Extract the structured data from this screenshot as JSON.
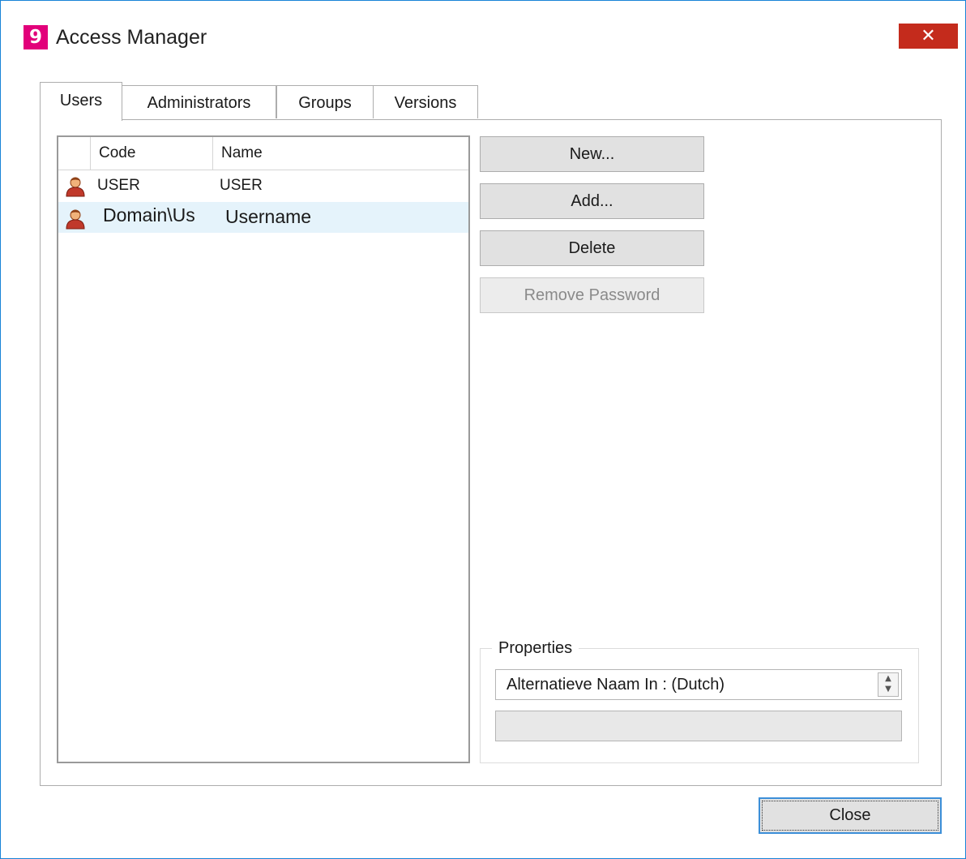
{
  "window": {
    "title": "Access Manager",
    "app_icon_glyph": "9",
    "close_glyph": "✕"
  },
  "tabs": [
    {
      "label": "Users",
      "active": true
    },
    {
      "label": "Administrators",
      "active": false
    },
    {
      "label": "Groups",
      "active": false
    },
    {
      "label": "Versions",
      "active": false
    }
  ],
  "user_list": {
    "columns": [
      "Code",
      "Name"
    ],
    "rows": [
      {
        "code": "USER",
        "name": "USER",
        "icon": "user-icon",
        "selected": false
      },
      {
        "code": "Domain\\Us",
        "name": "Username",
        "icon": "user-icon",
        "selected": true
      }
    ]
  },
  "actions": {
    "new_label": "New...",
    "add_label": "Add...",
    "delete_label": "Delete",
    "remove_password_label": "Remove Password"
  },
  "properties": {
    "title": "Properties",
    "selected_property": "Alternatieve Naam In : (Dutch)",
    "value": ""
  },
  "footer": {
    "close_label": "Close"
  },
  "colors": {
    "accent_border": "#1883d7",
    "brand_icon": "#e2007a",
    "close_button": "#c42b1c",
    "selection": "#e5f3fb"
  }
}
